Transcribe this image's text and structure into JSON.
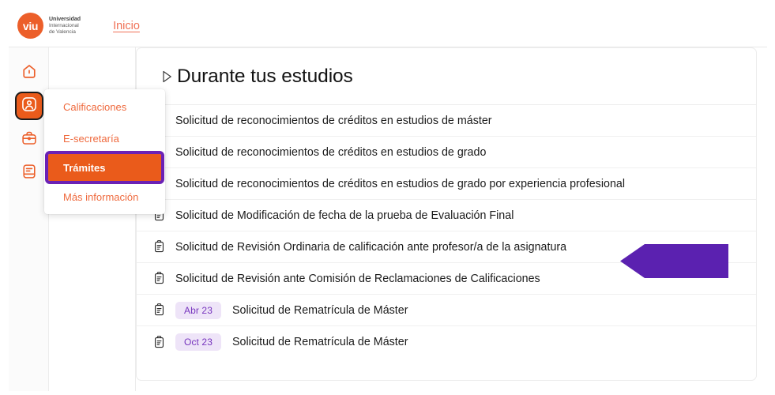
{
  "brand": {
    "mark": "viu",
    "line1": "Universidad",
    "line2": "Internacional",
    "line3": "de Valencia",
    "accent": "#ec5f2a"
  },
  "topnav": {
    "inicio_label": "Inicio",
    "link_color": "#f07055"
  },
  "rail": {
    "items": [
      {
        "name": "home-icon",
        "icon": "home",
        "active": false
      },
      {
        "name": "profile-icon",
        "icon": "user",
        "active": true
      },
      {
        "name": "briefcase-icon",
        "icon": "briefcase",
        "active": false
      },
      {
        "name": "document-icon",
        "icon": "document",
        "active": false
      }
    ],
    "active_bg": "#ea5b1b",
    "icon_color": "#ec5f2a"
  },
  "dropdown": {
    "items": [
      {
        "label": "Calificaciones",
        "selected": false
      },
      {
        "label": "E-secretaría",
        "selected": false
      },
      {
        "label": "Trámites",
        "selected": true
      },
      {
        "label": "Más información",
        "selected": false
      }
    ],
    "selected_bg": "#ea5b1b",
    "highlight_outline": "#6b21b5"
  },
  "panel": {
    "title": "Durante tus estudios",
    "expander_icon": "triangle-right-icon",
    "rows": [
      {
        "icon": "clipboard-icon",
        "badge": null,
        "label": "Solicitud de reconocimientos de créditos en estudios de máster"
      },
      {
        "icon": "clipboard-icon",
        "badge": null,
        "label": "Solicitud de reconocimientos de créditos en estudios de grado"
      },
      {
        "icon": "clipboard-icon",
        "badge": null,
        "label": "Solicitud de reconocimientos de créditos en estudios de grado por experiencia profesional"
      },
      {
        "icon": "clipboard-icon",
        "badge": null,
        "label": "Solicitud de Modificación de fecha de la prueba de Evaluación Final"
      },
      {
        "icon": "clipboard-icon",
        "badge": null,
        "label": "Solicitud de Revisión Ordinaria de calificación ante profesor/a de la asignatura"
      },
      {
        "icon": "clipboard-icon",
        "badge": null,
        "label": "Solicitud de Revisión ante Comisión de Reclamaciones de Calificaciones"
      },
      {
        "icon": "clipboard-icon",
        "badge": "Abr 23",
        "label": "Solicitud de Rematrícula de Máster"
      },
      {
        "icon": "clipboard-icon",
        "badge": "Oct 23",
        "label": "Solicitud de Rematrícula de Máster"
      }
    ],
    "badge_bg": "#eee4f8",
    "badge_color": "#7735be"
  },
  "annotation": {
    "arrow_icon": "left-arrow-annotation",
    "arrow_color": "#5b21b0",
    "points_at_row_index": 4
  }
}
